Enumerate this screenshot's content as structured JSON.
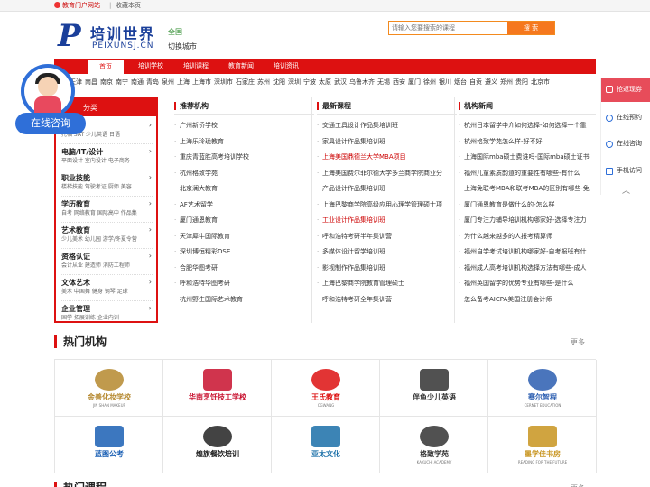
{
  "topbar": {
    "portal": "教育门户网站",
    "sep": "|",
    "favorite": "收藏本页"
  },
  "logo": {
    "mark": "P",
    "cn": "培训世界",
    "en": "PEIXUNSJ.CN"
  },
  "location": {
    "city": "全国",
    "switch": "切换城市"
  },
  "search": {
    "placeholder": "请输入您要搜索的课程",
    "button": "搜 索"
  },
  "nav": [
    "首页",
    "培训学校",
    "培训课程",
    "教育新闻",
    "培训资讯"
  ],
  "cities": [
    "北京",
    "天津",
    "南昌",
    "南京",
    "南宁",
    "南通",
    "青岛",
    "泉州",
    "上海",
    "上海市",
    "深圳市",
    "石家庄",
    "苏州",
    "沈阳",
    "深圳",
    "宁波",
    "太原",
    "武汉",
    "乌鲁木齐",
    "无锡",
    "西安",
    "厦门",
    "徐州",
    "银川",
    "烟台",
    "自贡",
    "遵义",
    "郑州",
    "贵阳",
    "北京市"
  ],
  "consult": {
    "label": "在线咨询"
  },
  "categories": {
    "header": "分类",
    "groups": [
      {
        "title": "语种",
        "sub": "托福 SAT 少儿英语 日语"
      },
      {
        "title": "电脑/IT/设计",
        "sub": "平面设计 室内设计 电子商务"
      },
      {
        "title": "职业技能",
        "sub": "楼梯技能 驾驶考证 厨师 美容"
      },
      {
        "title": "学历教育",
        "sub": "自考 网络教育 国际高中 作品集"
      },
      {
        "title": "艺术教育",
        "sub": "少儿美术 幼儿园 游学/冬夏令营"
      },
      {
        "title": "资格认证",
        "sub": "会计从业 建造师 消防工程师"
      },
      {
        "title": "文体艺术",
        "sub": "美术 中国舞 健身 钢琴 足球"
      },
      {
        "title": "企业管理",
        "sub": "国学 拓展训练 企业内训"
      }
    ]
  },
  "columns": [
    {
      "title": "推荐机构",
      "items": [
        "广州新侨学校",
        "上海乐玲珑教育",
        "重庆青蓝胜高考培训学校",
        "杭州格致学苑",
        "北京澜大教育",
        "AF艺术留学",
        "厦门通恩教育",
        "天津犀牛国际教育",
        "深圳博恒精彩DSE",
        "合肥华图考研",
        "呼和浩特华图考研",
        "杭州野生国际艺术教育"
      ]
    },
    {
      "title": "最新课程",
      "items": [
        "交通工具设计作品集培训班",
        "家具设计作品集培训班",
        "上海美国鼎德兰大学MBA项目",
        "上海美国费尔菲尔德大学多兰商学院商业分",
        "产品设计作品集培训班",
        "上海巴黎商学院高级应用心理学管理硕士项",
        "工业设计作品集培训班",
        "呼和浩特考研半年集训营",
        "多媒体设计留学培训班",
        "影视制作作品集培训班",
        "上海巴黎商学院教育管理硕士",
        "呼和浩特考研全年集训营"
      ]
    },
    {
      "title": "机构新闻",
      "items": [
        "杭州日本留学中介如何选择-如何选择一个靠",
        "杭州格致学苑怎么样-好不好",
        "上海国际mba硕士费谁吗-国际mba硕士证书",
        "福州儿童素质韵道的重要性有哪些-有什么",
        "上海免联考MBA和联考MBA的区别有哪些-免",
        "厦门通恩教育是做什么的-怎么样",
        "厦门专注力辅导培训机构哪家好-选择专注力",
        "为什么越来越多的人报考精算师",
        "福州自学考试培训机构哪家好-自考报班有什",
        "福州成人高考培训机构选择方法有哪些-成人",
        "福州英国留学的优势专业有哪些-是什么",
        "怎么备考AICPA美国注册会计师"
      ]
    }
  ],
  "sidebar": {
    "top": "抢返现券",
    "items": [
      "在线预约",
      "在线咨询",
      "手机访问"
    ],
    "up": "︿"
  },
  "hot": {
    "title": "热门机构",
    "more": "更多",
    "items": [
      {
        "name": "金善化妆学校",
        "sub": "JIN SHAN MAKEUP",
        "color": "#b5882e"
      },
      {
        "name": "华南烹饪技工学校",
        "sub": "",
        "color": "#c8102e"
      },
      {
        "name": "王氏教育",
        "sub": "CGWANG",
        "color": "#d11"
      },
      {
        "name": "伴鱼少儿英语",
        "sub": "",
        "color": "#333"
      },
      {
        "name": "赛尔智程",
        "sub": "CERNET EDUCATION",
        "color": "#2a5db0"
      },
      {
        "name": "蓝图公考",
        "sub": "",
        "color": "#1a5fb4"
      },
      {
        "name": "煌旗餐饮培训",
        "sub": "",
        "color": "#222"
      },
      {
        "name": "亚太文化",
        "sub": "",
        "color": "#1a6fa8"
      },
      {
        "name": "格致学苑",
        "sub": "KAKUCHI ACADEMY",
        "color": "#333"
      },
      {
        "name": "墨学佳书房",
        "sub": "READING FOR THE FUTURE",
        "color": "#c8941e"
      }
    ]
  },
  "next_section": {
    "title": "热门课程",
    "more": "更多"
  }
}
